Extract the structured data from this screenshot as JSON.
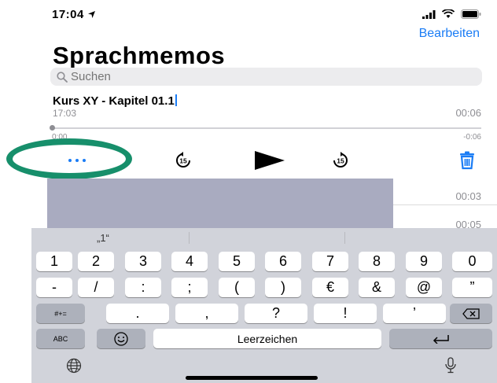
{
  "status": {
    "time": "17:04",
    "location_icon": "location-arrow-icon",
    "signal_icon": "signal-icon",
    "wifi_icon": "wifi-icon",
    "battery_icon": "battery-icon"
  },
  "header": {
    "edit_label": "Bearbeiten",
    "title": "Sprachmemos"
  },
  "search": {
    "placeholder": "Suchen",
    "value": ""
  },
  "memo": {
    "title": "Kurs XY - Kapitel 01.1",
    "time": "17:03",
    "duration": "00:06",
    "elapsed": "0:00",
    "remaining": "-0:06",
    "progress": 0
  },
  "controls": {
    "skip_back_label": "15",
    "skip_forward_label": "15",
    "more_icon": "ellipsis-icon",
    "play_icon": "play-icon",
    "trash_icon": "trash-icon"
  },
  "list": {
    "durations": [
      "00:03",
      "00:05"
    ]
  },
  "keyboard": {
    "suggestion": "„1“",
    "row1": [
      "1",
      "2",
      "3",
      "4",
      "5",
      "6",
      "7",
      "8",
      "9",
      "0"
    ],
    "row2": [
      "-",
      "/",
      ":",
      ";",
      "(",
      ")",
      "€",
      "&",
      "@",
      "”"
    ],
    "row3_left": "#+=",
    "row3": [
      ".",
      ",",
      "?",
      "!",
      "’"
    ],
    "backspace_icon": "backspace-icon",
    "abc_label": "ABC",
    "emoji_icon": "emoji-icon",
    "space_label": "Leerzeichen",
    "return_icon": "return-icon",
    "globe_icon": "globe-icon",
    "mic_icon": "microphone-icon"
  },
  "colors": {
    "accent": "#1a7cf5",
    "highlight_ring": "#178f6b",
    "overlay": "#a9abc0",
    "keyboard_bg": "#d1d3da"
  }
}
